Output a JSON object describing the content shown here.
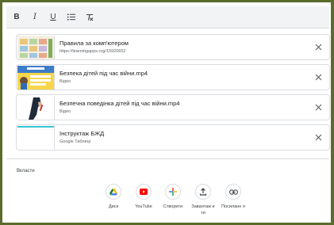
{
  "toolbar": {
    "bold": "B",
    "italic": "I",
    "underline": "U",
    "list": "list-icon",
    "clear_format": "clear-format-icon"
  },
  "attachments": [
    {
      "title": "Правила за комп'ютером",
      "subtitle": "https://learningapps.org/15920652",
      "thumb": "app-grid-thumb"
    },
    {
      "title": "Безпека дітей під час війни.mp4",
      "subtitle": "Відео",
      "thumb": "video-poster-thumb"
    },
    {
      "title": "Безпечна поведінка дітей під час війни.mp4",
      "subtitle": "Відео",
      "thumb": "hand-drawing-thumb"
    },
    {
      "title": "Інструктаж БЖД",
      "subtitle": "Google Таблиці",
      "thumb": "sheet-thumb"
    }
  ],
  "embed": {
    "label": "Вкласти",
    "items": [
      {
        "label": "Диск",
        "icon": "drive-icon"
      },
      {
        "label": "YouTube",
        "icon": "youtube-icon"
      },
      {
        "label": "Створити",
        "icon": "create-plus-icon"
      },
      {
        "label": "Завантаж ити",
        "icon": "upload-icon"
      },
      {
        "label": "Посиланн я",
        "icon": "link-icon"
      }
    ]
  },
  "colors": {
    "frame_border": "#5a6b2b",
    "drive_green": "#188038",
    "drive_blue": "#4285f4",
    "drive_yellow": "#fbbc04",
    "youtube_red": "#ff0000"
  }
}
